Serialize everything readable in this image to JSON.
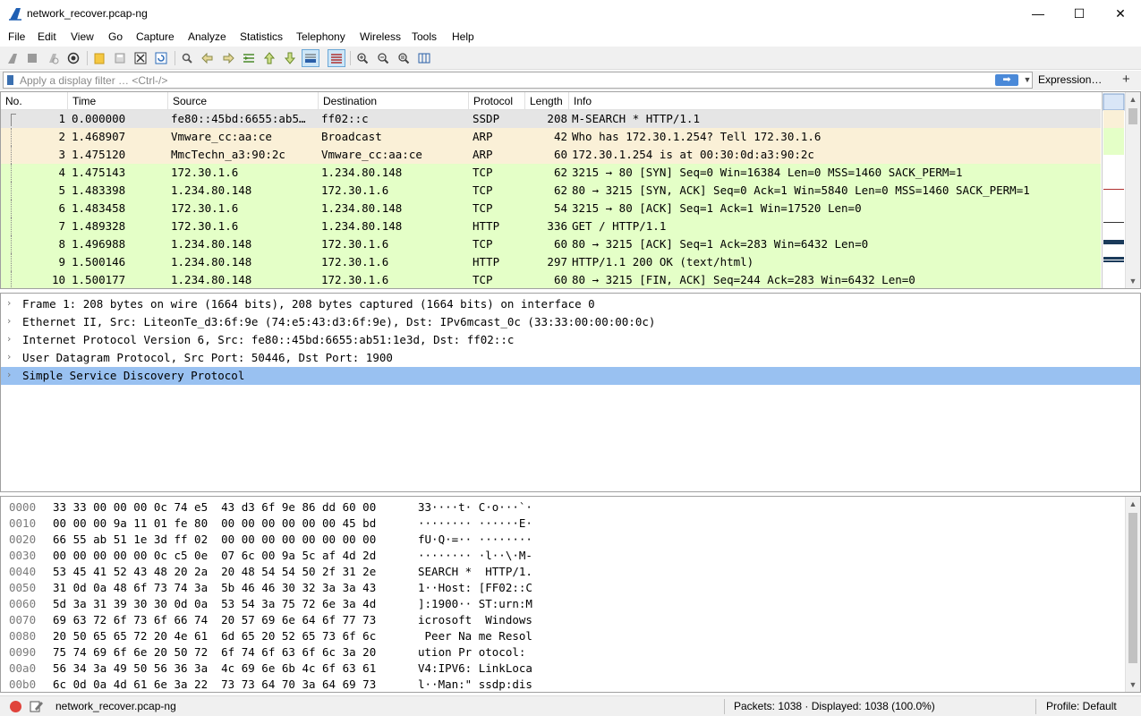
{
  "window": {
    "title": "network_recover.pcap-ng",
    "minimize": "—",
    "maximize": "☐",
    "close": "✕"
  },
  "menu": [
    "File",
    "Edit",
    "View",
    "Go",
    "Capture",
    "Analyze",
    "Statistics",
    "Telephony",
    "Wireless",
    "Tools",
    "Help"
  ],
  "filter": {
    "placeholder": "Apply a display filter … <Ctrl-/>",
    "value": "",
    "expression_label": "Expression…",
    "plus_label": "+"
  },
  "columns": [
    "No.",
    "Time",
    "Source",
    "Destination",
    "Protocol",
    "Length",
    "Info"
  ],
  "colors": {
    "ssdp_row": "#ffffff",
    "arp_row": "#faf0d7",
    "tcp_row": "#e4ffc7",
    "selected_row": "#e5e5e5",
    "selected_detail": "#99c1f1"
  },
  "packets": [
    {
      "no": "1",
      "time": "0.000000",
      "src": "fe80::45bd:6655:ab5…",
      "dst": "ff02::c",
      "proto": "SSDP",
      "len": "208",
      "info": "M-SEARCH * HTTP/1.1",
      "kind": "selected"
    },
    {
      "no": "2",
      "time": "1.468907",
      "src": "Vmware_cc:aa:ce",
      "dst": "Broadcast",
      "proto": "ARP",
      "len": "42",
      "info": "Who has 172.30.1.254? Tell 172.30.1.6",
      "kind": "arp"
    },
    {
      "no": "3",
      "time": "1.475120",
      "src": "MmcTechn_a3:90:2c",
      "dst": "Vmware_cc:aa:ce",
      "proto": "ARP",
      "len": "60",
      "info": "172.30.1.254 is at 00:30:0d:a3:90:2c",
      "kind": "arp"
    },
    {
      "no": "4",
      "time": "1.475143",
      "src": "172.30.1.6",
      "dst": "1.234.80.148",
      "proto": "TCP",
      "len": "62",
      "info": "3215 → 80 [SYN] Seq=0 Win=16384 Len=0 MSS=1460 SACK_PERM=1",
      "kind": "tcp"
    },
    {
      "no": "5",
      "time": "1.483398",
      "src": "1.234.80.148",
      "dst": "172.30.1.6",
      "proto": "TCP",
      "len": "62",
      "info": "80 → 3215 [SYN, ACK] Seq=0 Ack=1 Win=5840 Len=0 MSS=1460 SACK_PERM=1",
      "kind": "tcp"
    },
    {
      "no": "6",
      "time": "1.483458",
      "src": "172.30.1.6",
      "dst": "1.234.80.148",
      "proto": "TCP",
      "len": "54",
      "info": "3215 → 80 [ACK] Seq=1 Ack=1 Win=17520 Len=0",
      "kind": "tcp"
    },
    {
      "no": "7",
      "time": "1.489328",
      "src": "172.30.1.6",
      "dst": "1.234.80.148",
      "proto": "HTTP",
      "len": "336",
      "info": "GET / HTTP/1.1",
      "kind": "tcp"
    },
    {
      "no": "8",
      "time": "1.496988",
      "src": "1.234.80.148",
      "dst": "172.30.1.6",
      "proto": "TCP",
      "len": "60",
      "info": "80 → 3215 [ACK] Seq=1 Ack=283 Win=6432 Len=0",
      "kind": "tcp"
    },
    {
      "no": "9",
      "time": "1.500146",
      "src": "1.234.80.148",
      "dst": "172.30.1.6",
      "proto": "HTTP",
      "len": "297",
      "info": "HTTP/1.1 200 OK  (text/html)",
      "kind": "tcp"
    },
    {
      "no": "10",
      "time": "1.500177",
      "src": "1.234.80.148",
      "dst": "172.30.1.6",
      "proto": "TCP",
      "len": "60",
      "info": "80 → 3215 [FIN, ACK] Seq=244 Ack=283 Win=6432 Len=0",
      "kind": "tcp"
    }
  ],
  "details": [
    "Frame 1: 208 bytes on wire (1664 bits), 208 bytes captured (1664 bits) on interface 0",
    "Ethernet II, Src: LiteonTe_d3:6f:9e (74:e5:43:d3:6f:9e), Dst: IPv6mcast_0c (33:33:00:00:00:0c)",
    "Internet Protocol Version 6, Src: fe80::45bd:6655:ab51:1e3d, Dst: ff02::c",
    "User Datagram Protocol, Src Port: 50446, Dst Port: 1900",
    "Simple Service Discovery Protocol"
  ],
  "details_selected_index": 4,
  "bytes": [
    {
      "off": "0000",
      "hex": "33 33 00 00 00 0c 74 e5  43 d3 6f 9e 86 dd 60 00",
      "ascii": "33····t· C·o···`·"
    },
    {
      "off": "0010",
      "hex": "00 00 00 9a 11 01 fe 80  00 00 00 00 00 00 45 bd",
      "ascii": "········ ······E·"
    },
    {
      "off": "0020",
      "hex": "66 55 ab 51 1e 3d ff 02  00 00 00 00 00 00 00 00",
      "ascii": "fU·Q·=·· ········"
    },
    {
      "off": "0030",
      "hex": "00 00 00 00 00 0c c5 0e  07 6c 00 9a 5c af 4d 2d",
      "ascii": "········ ·l··\\·M-"
    },
    {
      "off": "0040",
      "hex": "53 45 41 52 43 48 20 2a  20 48 54 54 50 2f 31 2e",
      "ascii": "SEARCH *  HTTP/1."
    },
    {
      "off": "0050",
      "hex": "31 0d 0a 48 6f 73 74 3a  5b 46 46 30 32 3a 3a 43",
      "ascii": "1··Host: [FF02::C"
    },
    {
      "off": "0060",
      "hex": "5d 3a 31 39 30 30 0d 0a  53 54 3a 75 72 6e 3a 4d",
      "ascii": "]:1900·· ST:urn:M"
    },
    {
      "off": "0070",
      "hex": "69 63 72 6f 73 6f 66 74  20 57 69 6e 64 6f 77 73",
      "ascii": "icrosoft  Windows"
    },
    {
      "off": "0080",
      "hex": "20 50 65 65 72 20 4e 61  6d 65 20 52 65 73 6f 6c",
      "ascii": " Peer Na me Resol"
    },
    {
      "off": "0090",
      "hex": "75 74 69 6f 6e 20 50 72  6f 74 6f 63 6f 6c 3a 20",
      "ascii": "ution Pr otocol: "
    },
    {
      "off": "00a0",
      "hex": "56 34 3a 49 50 56 36 3a  4c 69 6e 6b 4c 6f 63 61",
      "ascii": "V4:IPV6: LinkLoca"
    },
    {
      "off": "00b0",
      "hex": "6c 0d 0a 4d 61 6e 3a 22  73 73 64 70 3a 64 69 73",
      "ascii": "l··Man:\" ssdp:dis"
    }
  ],
  "status": {
    "file": "network_recover.pcap-ng",
    "packets": "Packets: 1038 · Displayed: 1038 (100.0%)",
    "profile": "Profile: Default"
  },
  "icons": {
    "app": "shark-fin-icon",
    "start": "shark-fin-start-icon",
    "stop": "stop-square-icon",
    "restart": "restart-icon",
    "options": "gear-icon",
    "open": "folder-icon",
    "save": "save-icon",
    "close_file": "close-file-icon",
    "reload": "reload-icon",
    "find": "magnifier-icon",
    "back": "arrow-left-icon",
    "forward": "arrow-right-icon",
    "goto": "goto-packet-icon",
    "first": "arrow-up-icon",
    "last": "arrow-down-icon",
    "autoscroll": "autoscroll-icon",
    "colorize": "colorize-icon",
    "zoom_in": "zoom-in-icon",
    "zoom_out": "zoom-out-icon",
    "zoom_reset": "zoom-reset-icon",
    "resize_columns": "resize-columns-icon"
  }
}
